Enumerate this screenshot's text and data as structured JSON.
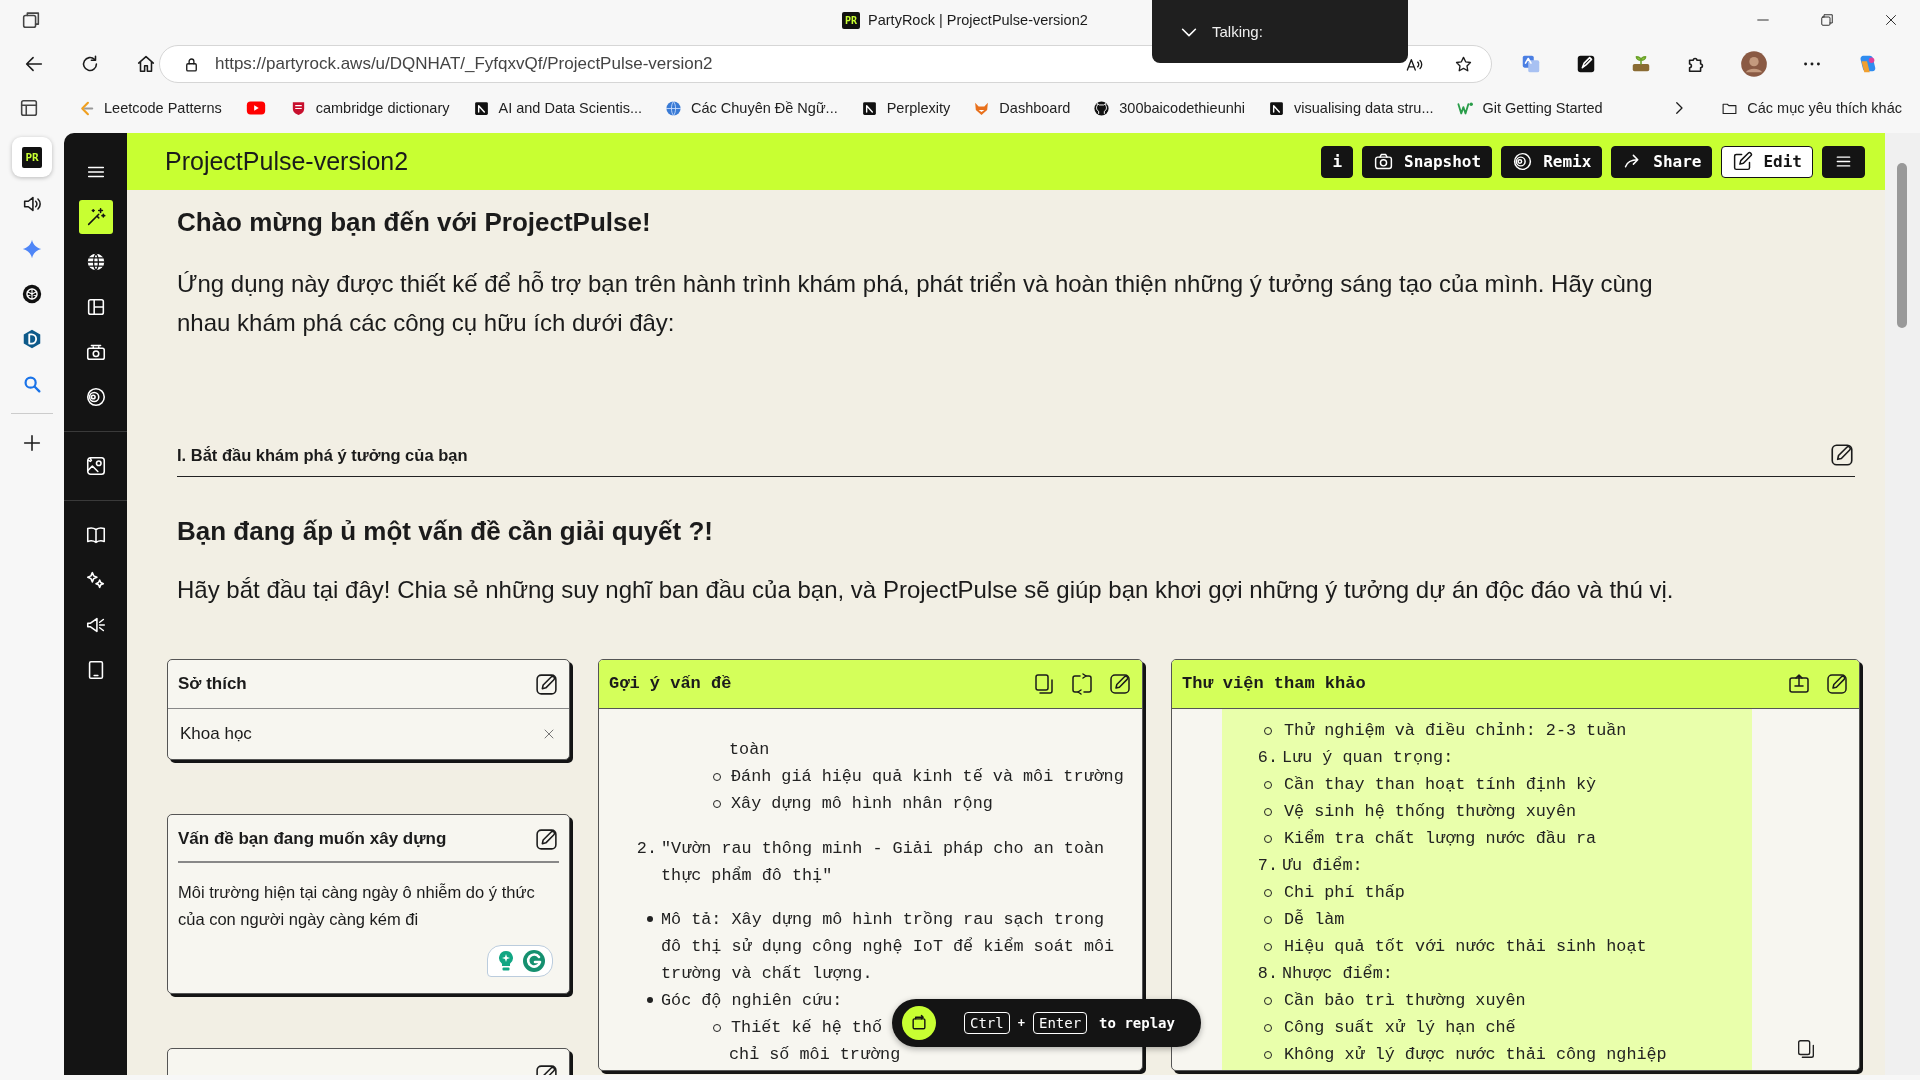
{
  "browser": {
    "tab": {
      "icon_label": "PR",
      "title": "PartyRock | ProjectPulse-version2"
    },
    "talking_popup": {
      "label": "Talking:"
    },
    "address": "https://partyrock.aws/u/DQNHAT/_FyfqxvQf/ProjectPulse-version2",
    "bookmarks": [
      {
        "kind": "chevron",
        "label": "Leetcode Patterns"
      },
      {
        "kind": "video"
      },
      {
        "kind": "shield",
        "label": "cambridge dictionary"
      },
      {
        "kind": "square",
        "label": "AI and Data Scientis..."
      },
      {
        "kind": "globe",
        "label": "Các Chuyên Đề Ngữ..."
      },
      {
        "kind": "square",
        "label": "Perplexity"
      },
      {
        "kind": "fox",
        "label": "Dashboard"
      },
      {
        "kind": "cat",
        "label": "300baicodethieunhi"
      },
      {
        "kind": "square",
        "label": "visualising data stru..."
      },
      {
        "kind": "w",
        "label": "Git Getting Started"
      }
    ],
    "other_bookmarks": "Các mục yêu thích khác",
    "sidebar": [
      {
        "kind": "app",
        "label": "PR",
        "selected": true
      },
      {
        "kind": "speaker",
        "selected": false
      },
      {
        "kind": "sparkle",
        "selected": false
      },
      {
        "kind": "knot",
        "selected": false
      },
      {
        "kind": "hex",
        "selected": false
      },
      {
        "kind": "search",
        "selected": false
      },
      {
        "kind": "add",
        "selected": false
      }
    ]
  },
  "app_sidebar": {
    "items": [
      {
        "kind": "menu",
        "selected": false
      },
      {
        "kind": "wand",
        "selected": true
      },
      {
        "kind": "globe",
        "selected": false
      },
      {
        "kind": "layout",
        "selected": false
      },
      {
        "kind": "camera",
        "selected": false
      },
      {
        "kind": "rings",
        "selected": false
      },
      {
        "kind": "image",
        "selected": false
      },
      {
        "kind": "book",
        "selected": false
      },
      {
        "kind": "sparkles",
        "selected": false
      },
      {
        "kind": "megaphone",
        "selected": false
      },
      {
        "kind": "tablet",
        "selected": false
      }
    ]
  },
  "app": {
    "title": "ProjectPulse-version2",
    "toolbar": [
      {
        "kind": "info",
        "label": "i"
      },
      {
        "kind": "snapshot",
        "label": "Snapshot"
      },
      {
        "kind": "remix",
        "label": "Remix"
      },
      {
        "kind": "share",
        "label": "Share"
      },
      {
        "kind": "edit",
        "label": "Edit"
      },
      {
        "kind": "menu"
      }
    ]
  },
  "content": {
    "welcome_title": "Chào mừng bạn đến với ProjectPulse!",
    "intro": "Ứng dụng này được thiết kế để hỗ trợ bạn trên hành trình khám phá, phát triển và hoàn thiện những ý tưởng sáng tạo của mình. Hãy cùng nhau khám phá các công cụ hữu ích dưới đây:",
    "section_label": "I. Bắt đầu khám phá ý tưởng của bạn",
    "question_title": "Bạn đang ấp ủ một vấn đề cần giải quyết ?!",
    "question_intro": "Hãy bắt đầu tại đây! Chia sẻ những suy nghĩ ban đầu của bạn, và ProjectPulse sẽ giúp bạn khơi gợi những ý tưởng dự án độc đáo và thú vị."
  },
  "inputs": [
    {
      "kind": "tag",
      "title": "Sở thích",
      "value": "Khoa học"
    },
    {
      "kind": "textarea",
      "title": "Vấn đề bạn đang muốn xây dựng",
      "value": "Môi trường hiện tại càng ngày ô nhiễm do ý thức của con người ngày càng kém đi"
    },
    {
      "kind": "cutoff"
    }
  ],
  "suggestions": {
    "title": "Gợi ý vấn đề",
    "lines": [
      {
        "kind": "sub-cont",
        "text": "toàn"
      },
      {
        "kind": "sub",
        "text": "Đánh giá hiệu quả kinh tế và môi trường"
      },
      {
        "kind": "sub",
        "text": "Xây dựng mô hình nhân rộng"
      },
      {
        "kind": "numbered",
        "number": "2.",
        "text": "\"Vườn rau thông minh - Giải pháp cho an toàn thực phẩm đô thị\""
      },
      {
        "kind": "bullet",
        "text": "Mô tả: Xây dựng mô hình trồng rau sạch trong đô thị sử dụng công nghệ IoT để kiểm soát môi trường và chất lượng."
      },
      {
        "kind": "bullet",
        "text": "Góc độ nghiên cứu:"
      },
      {
        "kind": "sub",
        "text": "Thiết kế hệ thố"
      },
      {
        "kind": "sub-cont",
        "text": "chỉ số môi trường"
      }
    ]
  },
  "library": {
    "title": "Thư viện tham khảo",
    "lines": [
      {
        "kind": "sub",
        "text": "Thử nghiệm và điều chỉnh: 2-3 tuần"
      },
      {
        "kind": "numbered",
        "number": "6.",
        "text": "Lưu ý quan trọng:"
      },
      {
        "kind": "sub",
        "text": "Cần thay than hoạt tính định kỳ"
      },
      {
        "kind": "sub",
        "text": "Vệ sinh hệ thống thường xuyên"
      },
      {
        "kind": "sub",
        "text": "Kiểm tra chất lượng nước đầu ra"
      },
      {
        "kind": "numbered",
        "number": "7.",
        "text": "Ưu điểm:"
      },
      {
        "kind": "sub",
        "text": "Chi phí thấp"
      },
      {
        "kind": "sub",
        "text": "Dễ làm"
      },
      {
        "kind": "sub",
        "text": "Hiệu quả tốt với nước thải sinh hoạt"
      },
      {
        "kind": "numbered",
        "number": "8.",
        "text": "Nhược điểm:"
      },
      {
        "kind": "sub",
        "text": "Cần bảo trì thường xuyên"
      },
      {
        "kind": "sub",
        "text": "Công suất xử lý hạn chế"
      },
      {
        "kind": "sub",
        "text": "Không xử lý được nước thải công nghiệp"
      }
    ]
  },
  "replay_toast": {
    "keys": [
      "Ctrl",
      "Enter"
    ],
    "joiner": "+",
    "hint": "to replay"
  }
}
